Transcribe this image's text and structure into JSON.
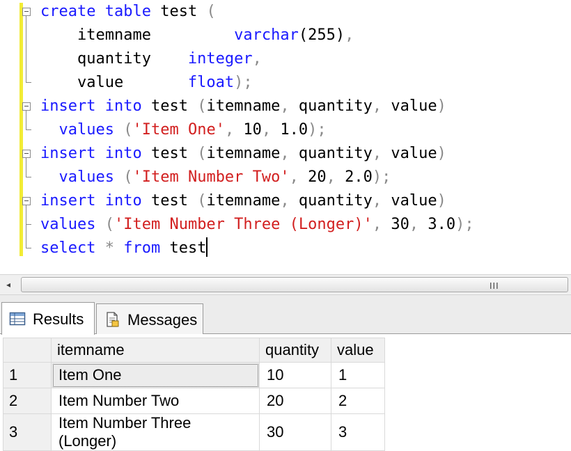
{
  "editor": {
    "lines": [
      [
        {
          "t": "create",
          "c": "kw"
        },
        {
          "t": " "
        },
        {
          "t": "table",
          "c": "kw"
        },
        {
          "t": " test "
        },
        {
          "t": "(",
          "c": "op"
        }
      ],
      [
        {
          "t": "    itemname         "
        },
        {
          "t": "varchar",
          "c": "kw"
        },
        {
          "t": "(255)"
        },
        {
          "t": ",",
          "c": "op"
        }
      ],
      [
        {
          "t": "    quantity    "
        },
        {
          "t": "integer",
          "c": "kw"
        },
        {
          "t": ",",
          "c": "op"
        }
      ],
      [
        {
          "t": "    value       "
        },
        {
          "t": "float",
          "c": "kw"
        },
        {
          "t": ");",
          "c": "op"
        }
      ],
      [
        {
          "t": "insert",
          "c": "kw"
        },
        {
          "t": " "
        },
        {
          "t": "into",
          "c": "kw"
        },
        {
          "t": " test "
        },
        {
          "t": "(",
          "c": "op"
        },
        {
          "t": "itemname"
        },
        {
          "t": ",",
          "c": "op"
        },
        {
          "t": " quantity"
        },
        {
          "t": ",",
          "c": "op"
        },
        {
          "t": " value"
        },
        {
          "t": ")",
          "c": "op"
        }
      ],
      [
        {
          "t": "  "
        },
        {
          "t": "values",
          "c": "kw"
        },
        {
          "t": " "
        },
        {
          "t": "(",
          "c": "op"
        },
        {
          "t": "'Item One'",
          "c": "str"
        },
        {
          "t": ",",
          "c": "op"
        },
        {
          "t": " 10"
        },
        {
          "t": ",",
          "c": "op"
        },
        {
          "t": " 1.0"
        },
        {
          "t": ");",
          "c": "op"
        }
      ],
      [
        {
          "t": "insert",
          "c": "kw"
        },
        {
          "t": " "
        },
        {
          "t": "into",
          "c": "kw"
        },
        {
          "t": " test "
        },
        {
          "t": "(",
          "c": "op"
        },
        {
          "t": "itemname"
        },
        {
          "t": ",",
          "c": "op"
        },
        {
          "t": " quantity"
        },
        {
          "t": ",",
          "c": "op"
        },
        {
          "t": " value"
        },
        {
          "t": ")",
          "c": "op"
        }
      ],
      [
        {
          "t": "  "
        },
        {
          "t": "values",
          "c": "kw"
        },
        {
          "t": " "
        },
        {
          "t": "(",
          "c": "op"
        },
        {
          "t": "'Item Number Two'",
          "c": "str"
        },
        {
          "t": ",",
          "c": "op"
        },
        {
          "t": " 20"
        },
        {
          "t": ",",
          "c": "op"
        },
        {
          "t": " 2.0"
        },
        {
          "t": ");",
          "c": "op"
        }
      ],
      [
        {
          "t": "insert",
          "c": "kw"
        },
        {
          "t": " "
        },
        {
          "t": "into",
          "c": "kw"
        },
        {
          "t": " test "
        },
        {
          "t": "(",
          "c": "op"
        },
        {
          "t": "itemname"
        },
        {
          "t": ",",
          "c": "op"
        },
        {
          "t": " quantity"
        },
        {
          "t": ",",
          "c": "op"
        },
        {
          "t": " value"
        },
        {
          "t": ")",
          "c": "op"
        }
      ],
      [
        {
          "t": "values",
          "c": "kw"
        },
        {
          "t": " "
        },
        {
          "t": "(",
          "c": "op"
        },
        {
          "t": "'Item Number Three (Longer)'",
          "c": "str"
        },
        {
          "t": ",",
          "c": "op"
        },
        {
          "t": " 30"
        },
        {
          "t": ",",
          "c": "op"
        },
        {
          "t": " 3.0"
        },
        {
          "t": ");",
          "c": "op"
        }
      ],
      [
        {
          "t": "select",
          "c": "kw"
        },
        {
          "t": " "
        },
        {
          "t": "*",
          "c": "op"
        },
        {
          "t": " "
        },
        {
          "t": "from",
          "c": "kw"
        },
        {
          "t": " test"
        }
      ]
    ]
  },
  "scrollbar": {
    "left_arrow": "◂",
    "grip": "III"
  },
  "tabs": {
    "results": "Results",
    "messages": "Messages"
  },
  "results": {
    "columns": [
      "itemname",
      "quantity",
      "value"
    ],
    "rows": [
      {
        "num": "1",
        "itemname": "Item One",
        "quantity": "10",
        "value": "1"
      },
      {
        "num": "2",
        "itemname": "Item Number Two",
        "quantity": "20",
        "value": "2"
      },
      {
        "num": "3",
        "itemname": "Item Number Three (Longer)",
        "quantity": "30",
        "value": "3"
      }
    ]
  },
  "colors": {
    "keyword": "#1a1aff",
    "string": "#d21f1f",
    "operator": "#8a8a8a",
    "change_bar": "#f2ec35"
  }
}
